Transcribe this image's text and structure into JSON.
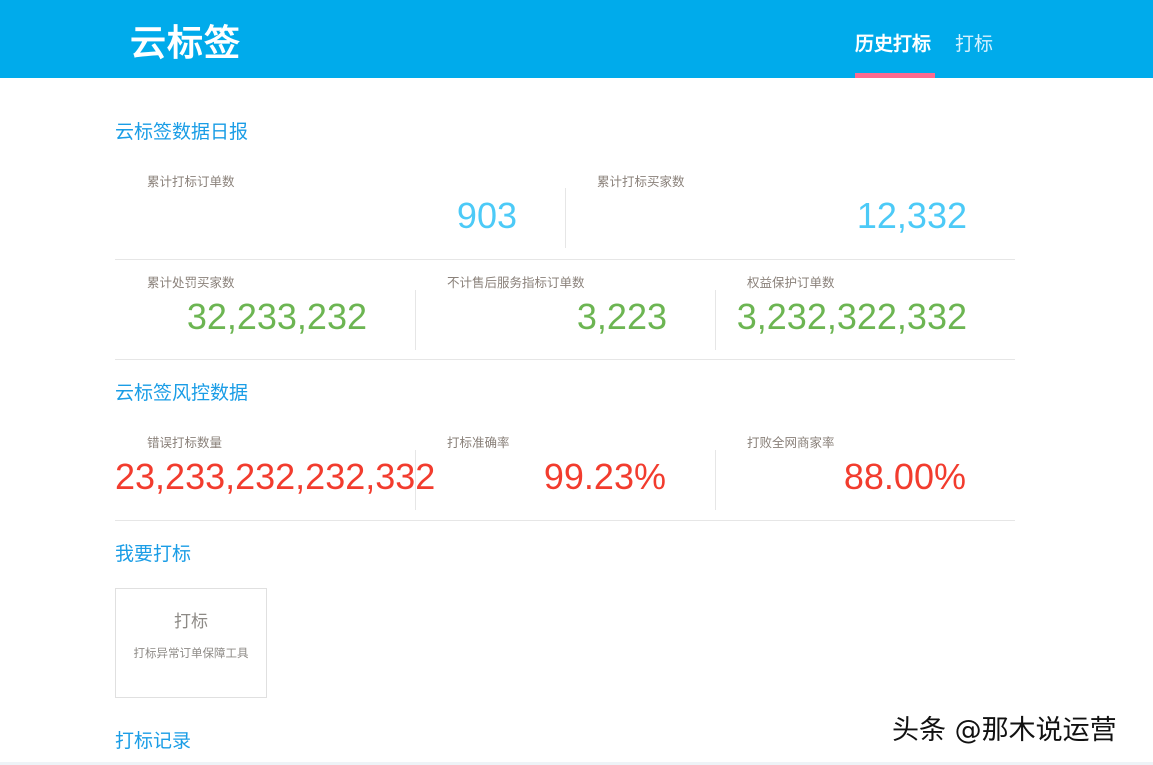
{
  "header": {
    "title": "云标签",
    "nav": [
      {
        "label": "历史打标",
        "active": true
      },
      {
        "label": "打标",
        "active": false
      }
    ]
  },
  "sections": {
    "daily": {
      "title": "云标签数据日报",
      "row1": [
        {
          "label": "累计打标订单数",
          "value": "903"
        },
        {
          "label": "累计打标买家数",
          "value": "12,332"
        }
      ],
      "row2": [
        {
          "label": "累计处罚买家数",
          "value": "32,233,232"
        },
        {
          "label": "不计售后服务指标订单数",
          "value": "3,223"
        },
        {
          "label": "权益保护订单数",
          "value": "3,232,322,332"
        }
      ]
    },
    "risk": {
      "title": "云标签风控数据",
      "row": [
        {
          "label": "错误打标数量",
          "value": "23,233,232,232,332"
        },
        {
          "label": "打标准确率",
          "value": "99.23%"
        },
        {
          "label": "打败全网商家率",
          "value": "88.00%"
        }
      ]
    },
    "mark": {
      "title": "我要打标",
      "card": {
        "title": "打标",
        "subtitle": "打标异常订单保障工具"
      }
    },
    "records": {
      "title": "打标记录"
    }
  },
  "watermark": "头条 @那木说运营",
  "colors": {
    "header": "#00abeb",
    "accent": "#ff6a8e",
    "blue": "#4ccaf7",
    "green": "#6cb552",
    "red": "#f23c2e"
  }
}
